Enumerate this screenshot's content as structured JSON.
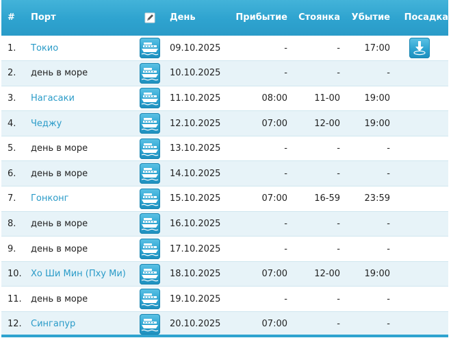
{
  "header": {
    "num": "#",
    "port": "Порт",
    "edit_icon": "edit-icon",
    "day": "День",
    "arrival": "Прибытие",
    "stay": "Стоянка",
    "departure": "Убытие",
    "boarding": "Посадка"
  },
  "colors": {
    "header_bg": "#2ea3cf",
    "link": "#2a9bc8",
    "row_alt": "#e7f3f8"
  },
  "rows": [
    {
      "num": "1.",
      "port": "Токио",
      "is_link": true,
      "day": "09.10.2025",
      "arrival": "-",
      "stay": "-",
      "departure": "17:00",
      "boarding": true
    },
    {
      "num": "2.",
      "port": "день в море",
      "is_link": false,
      "day": "10.10.2025",
      "arrival": "-",
      "stay": "-",
      "departure": "-",
      "boarding": false
    },
    {
      "num": "3.",
      "port": "Нагасаки",
      "is_link": true,
      "day": "11.10.2025",
      "arrival": "08:00",
      "stay": "11-00",
      "departure": "19:00",
      "boarding": false
    },
    {
      "num": "4.",
      "port": "Чеджу",
      "is_link": true,
      "day": "12.10.2025",
      "arrival": "07:00",
      "stay": "12-00",
      "departure": "19:00",
      "boarding": false
    },
    {
      "num": "5.",
      "port": "день в море",
      "is_link": false,
      "day": "13.10.2025",
      "arrival": "-",
      "stay": "-",
      "departure": "-",
      "boarding": false
    },
    {
      "num": "6.",
      "port": "день в море",
      "is_link": false,
      "day": "14.10.2025",
      "arrival": "-",
      "stay": "-",
      "departure": "-",
      "boarding": false
    },
    {
      "num": "7.",
      "port": "Гонконг",
      "is_link": true,
      "day": "15.10.2025",
      "arrival": "07:00",
      "stay": "16-59",
      "departure": "23:59",
      "boarding": false
    },
    {
      "num": "8.",
      "port": "день в море",
      "is_link": false,
      "day": "16.10.2025",
      "arrival": "-",
      "stay": "-",
      "departure": "-",
      "boarding": false
    },
    {
      "num": "9.",
      "port": "день в море",
      "is_link": false,
      "day": "17.10.2025",
      "arrival": "-",
      "stay": "-",
      "departure": "-",
      "boarding": false
    },
    {
      "num": "10.",
      "port": "Хо Ши Мин (Пху Ми)",
      "is_link": true,
      "day": "18.10.2025",
      "arrival": "07:00",
      "stay": "12-00",
      "departure": "19:00",
      "boarding": false
    },
    {
      "num": "11.",
      "port": "день в море",
      "is_link": false,
      "day": "19.10.2025",
      "arrival": "-",
      "stay": "-",
      "departure": "-",
      "boarding": false
    },
    {
      "num": "12.",
      "port": "Сингапур",
      "is_link": true,
      "day": "20.10.2025",
      "arrival": "07:00",
      "stay": "-",
      "departure": "-",
      "boarding": false
    }
  ],
  "icons": {
    "ship": "ship-icon",
    "boarding": "boarding-download-icon"
  }
}
